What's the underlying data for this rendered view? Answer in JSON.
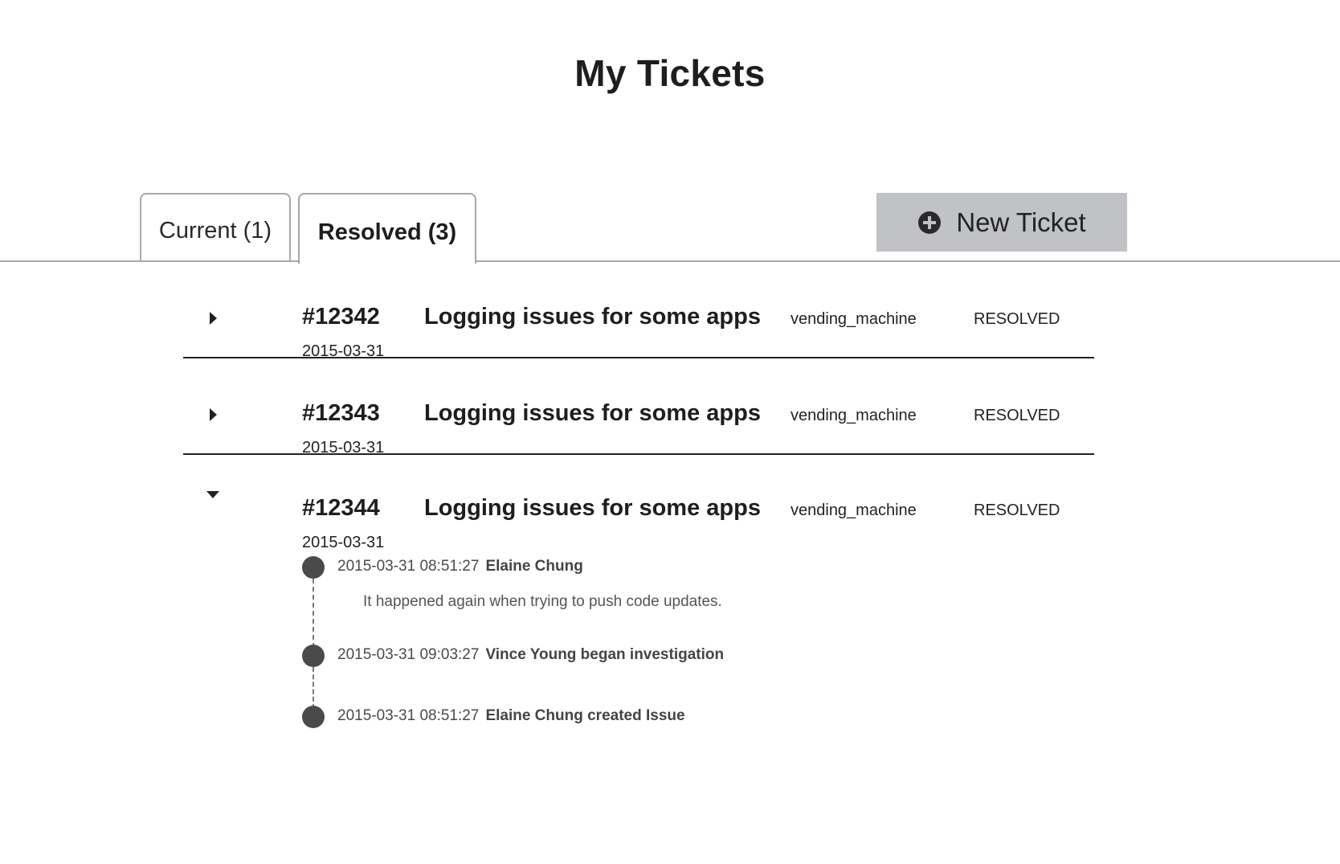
{
  "page": {
    "title": "My Tickets"
  },
  "tabs": [
    {
      "label": "Current (1)",
      "active": false
    },
    {
      "label": "Resolved (3)",
      "active": true
    }
  ],
  "toolbar": {
    "new_ticket_label": "New Ticket",
    "new_ticket_icon": "plus-circle-icon"
  },
  "tickets": [
    {
      "id": "#12342",
      "date": "2015-03-31",
      "title": "Logging issues for some apps",
      "source": "vending_machine",
      "status": "RESOLVED",
      "expanded": false
    },
    {
      "id": "#12343",
      "date": "2015-03-31",
      "title": "Logging issues for some apps",
      "source": "vending_machine",
      "status": "RESOLVED",
      "expanded": false
    },
    {
      "id": "#12344",
      "date": "2015-03-31",
      "title": "Logging issues for some apps",
      "source": "vending_machine",
      "status": "RESOLVED",
      "expanded": true,
      "timeline": [
        {
          "timestamp": "2015-03-31 08:51:27",
          "actor": "Elaine Chung",
          "comment": "It happened again when trying to push  code updates."
        },
        {
          "timestamp": "2015-03-31 09:03:27",
          "actor": "Vince Young began investigation"
        },
        {
          "timestamp": "2015-03-31 08:51:27",
          "actor": "Elaine Chung created Issue"
        }
      ]
    }
  ],
  "colors": {
    "button_bg": "#c0c2c5",
    "tab_border": "#a8a8a8",
    "row_divider": "#222222",
    "timeline_dot": "#4a4a4a"
  }
}
